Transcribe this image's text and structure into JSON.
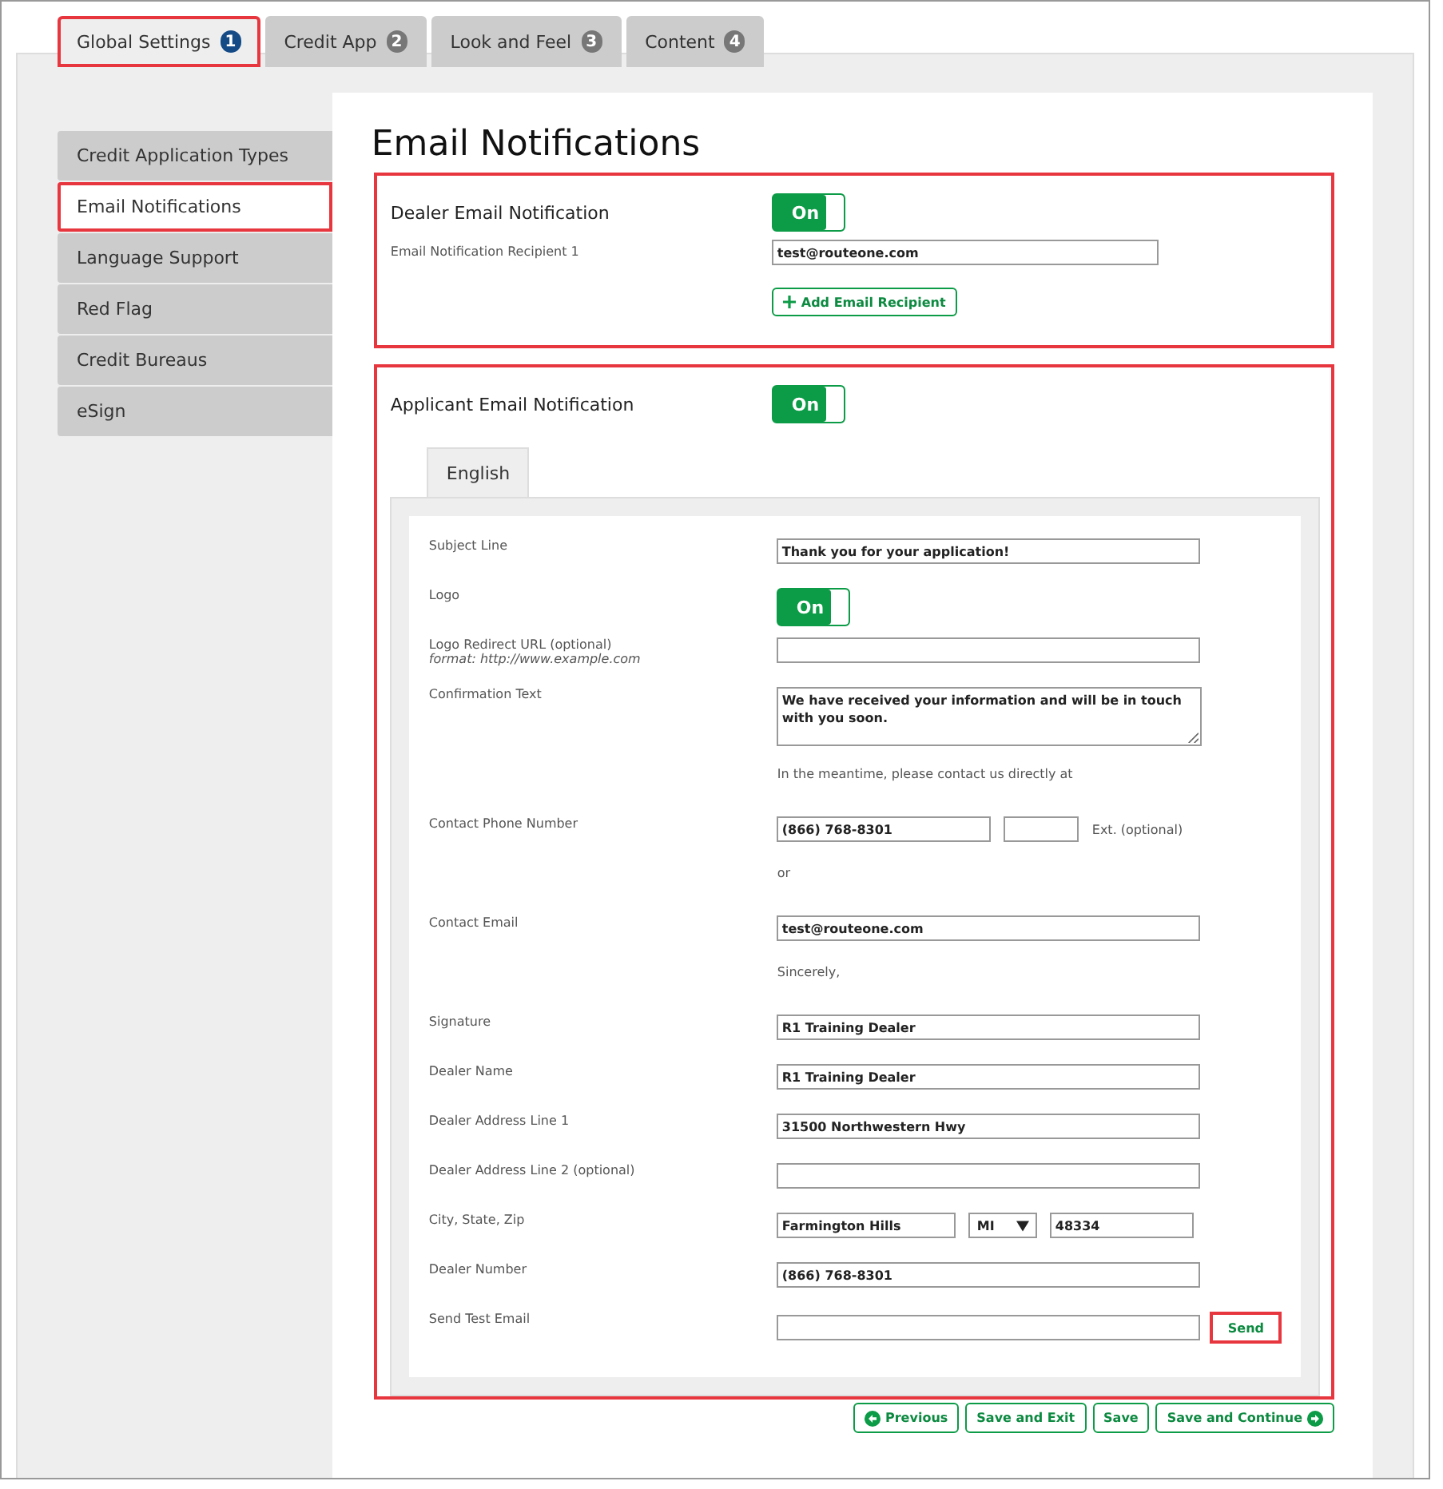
{
  "tabs": [
    {
      "label": "Global Settings",
      "badge": "1",
      "selected": true,
      "highlighted": true
    },
    {
      "label": "Credit App",
      "badge": "2",
      "selected": false,
      "highlighted": false
    },
    {
      "label": "Look and Feel",
      "badge": "3",
      "selected": false,
      "highlighted": false
    },
    {
      "label": "Content",
      "badge": "4",
      "selected": false,
      "highlighted": false
    }
  ],
  "sidebar": {
    "items": [
      {
        "label": "Credit Application Types",
        "selected": false,
        "highlighted": false
      },
      {
        "label": "Email Notifications",
        "selected": true,
        "highlighted": true
      },
      {
        "label": "Language Support",
        "selected": false,
        "highlighted": false
      },
      {
        "label": "Red Flag",
        "selected": false,
        "highlighted": false
      },
      {
        "label": "Credit Bureaus",
        "selected": false,
        "highlighted": false
      },
      {
        "label": "eSign",
        "selected": false,
        "highlighted": false
      }
    ]
  },
  "title": "Email Notifications",
  "dealer_section": {
    "title": "Dealer Email Notification",
    "highlighted": true,
    "toggle": {
      "label": "On",
      "on": true
    },
    "recipients": [
      {
        "label": "Email Notification Recipient 1",
        "value": "test@routeone.com"
      }
    ],
    "add_button": "Add Email Recipient"
  },
  "applicant_section": {
    "title": "Applicant Email Notification",
    "highlighted": true,
    "toggle": {
      "label": "On",
      "on": true
    },
    "language_tabs": [
      {
        "label": "English",
        "selected": true
      }
    ],
    "rows": [
      {
        "kind": "text",
        "label": "Subject Line",
        "value": "Thank you for your application!"
      },
      {
        "kind": "toggle",
        "label": "Logo",
        "toggle": {
          "label": "On",
          "on": true
        }
      },
      {
        "kind": "text",
        "label": "Logo Redirect URL (optional)",
        "hint": "format: http://www.example.com"
      },
      {
        "kind": "textarea",
        "label": "Confirmation Text",
        "value": "We have received your information and will be in touch with you soon."
      },
      {
        "kind": "note",
        "text": "In the meantime, please contact us directly at"
      },
      {
        "kind": "phone",
        "label": "Contact Phone Number",
        "value": "(866) 768-8301",
        "ext_label": "Ext. (optional)"
      },
      {
        "kind": "note",
        "text": "or"
      },
      {
        "kind": "text",
        "label": "Contact Email",
        "value": "test@routeone.com"
      },
      {
        "kind": "note",
        "text": "Sincerely,"
      },
      {
        "kind": "text",
        "label": "Signature",
        "value": "R1 Training Dealer"
      },
      {
        "kind": "text",
        "label": "Dealer Name",
        "value": "R1 Training Dealer"
      },
      {
        "kind": "text",
        "label": "Dealer Address Line 1",
        "value": "31500 Northwestern Hwy"
      },
      {
        "kind": "text",
        "label": "Dealer Address Line 2 (optional)"
      },
      {
        "kind": "city",
        "label": "City, State, Zip",
        "city": "Farmington Hills",
        "state": "MI",
        "zip": "48334"
      },
      {
        "kind": "text",
        "label": "Dealer Number",
        "value": "(866) 768-8301"
      },
      {
        "kind": "send",
        "label": "Send Test Email",
        "button": "Send",
        "highlighted": true
      }
    ]
  },
  "footer_buttons": [
    {
      "kind": "previous",
      "label": "Previous"
    },
    {
      "kind": "plain",
      "label": "Save and Exit"
    },
    {
      "kind": "plain",
      "label": "Save"
    },
    {
      "kind": "next",
      "label": "Save and Continue"
    }
  ]
}
